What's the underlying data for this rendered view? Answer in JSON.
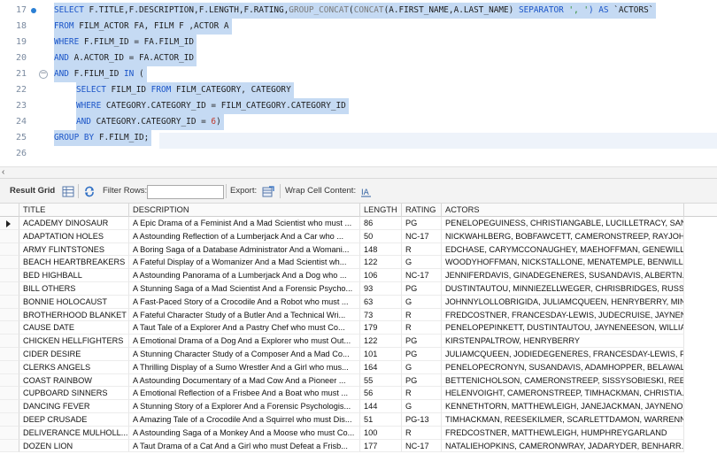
{
  "editor": {
    "lines": [
      {
        "num": "17"
      },
      {
        "num": "18"
      },
      {
        "num": "19"
      },
      {
        "num": "20"
      },
      {
        "num": "21"
      },
      {
        "num": "22"
      },
      {
        "num": "23"
      },
      {
        "num": "24"
      },
      {
        "num": "25"
      },
      {
        "num": "26"
      }
    ],
    "fold_glyph": "−",
    "tokens": {
      "l17_select": "SELECT ",
      "l17_cols": "F.TITLE,F.DESCRIPTION,F.LENGTH,F.RATING,",
      "l17_gc": "GROUP_CONCAT",
      "l17_p1": "(",
      "l17_concat": "CONCAT",
      "l17_args": "(A.FIRST_NAME,A.LAST_NAME) ",
      "l17_sep": "SEPARATOR ",
      "l17_str": "', '",
      "l17_as": ") AS ",
      "l17_alias": "`ACTORS`",
      "l18_from": "FROM ",
      "l18_rest": "FILM_ACTOR FA, FILM F ,ACTOR A",
      "l19_where": "WHERE ",
      "l19_rest": "F.FILM_ID = FA.FILM_ID",
      "l20_and": "AND ",
      "l20_rest": "A.ACTOR_ID = FA.ACTOR_ID",
      "l21_and": "AND ",
      "l21_mid": "F.FILM_ID ",
      "l21_in": "IN ",
      "l21_paren": "(",
      "l22_select": "SELECT ",
      "l22_mid": "FILM_ID ",
      "l22_from": "FROM ",
      "l22_rest": "FILM_CATEGORY, CATEGORY",
      "l23_where": "WHERE ",
      "l23_rest": "CATEGORY.CATEGORY_ID = FILM_CATEGORY.CATEGORY_ID",
      "l24_and": "AND ",
      "l24_mid": "CATEGORY.CATEGORY_ID = ",
      "l24_num": "6",
      "l24_close": ")",
      "l25_group": "GROUP BY ",
      "l25_rest": "F.FILM_ID;"
    }
  },
  "toolbar": {
    "result_grid_label": "Result Grid",
    "filter_rows_label": "Filter Rows:",
    "filter_rows_value": "",
    "export_label": "Export:",
    "wrap_label": "Wrap Cell Content:"
  },
  "grid": {
    "columns": [
      "TITLE",
      "DESCRIPTION",
      "LENGTH",
      "RATING",
      "ACTORS"
    ],
    "rows": [
      {
        "title": "ACADEMY DINOSAUR",
        "description": "A Epic Drama of a Feminist And a Mad Scientist who must ...",
        "length": "86",
        "rating": "PG",
        "actors": "PENELOPEGUINESS, CHRISTIANGABLE, LUCILLETRACY, SAN..."
      },
      {
        "title": "ADAPTATION HOLES",
        "description": "A Astounding Reflection of a Lumberjack And a Car who ...",
        "length": "50",
        "rating": "NC-17",
        "actors": "NICKWAHLBERG, BOBFAWCETT, CAMERONSTREEP, RAYJOH..."
      },
      {
        "title": "ARMY FLINTSTONES",
        "description": "A Boring Saga of a Database Administrator And a Womani...",
        "length": "148",
        "rating": "R",
        "actors": "EDCHASE, CARYMCCONAUGHEY, MAEHOFFMAN, GENEWILLI..."
      },
      {
        "title": "BEACH HEARTBREAKERS",
        "description": "A Fateful Display of a Womanizer And a Mad Scientist wh...",
        "length": "122",
        "rating": "G",
        "actors": "WOODYHOFFMAN, NICKSTALLONE, MENATEMPLE, BENWILLI..."
      },
      {
        "title": "BED HIGHBALL",
        "description": "A Astounding Panorama of a Lumberjack And a Dog who ...",
        "length": "106",
        "rating": "NC-17",
        "actors": "JENNIFERDAVIS, GINADEGENERES, SUSANDAVIS, ALBERTN..."
      },
      {
        "title": "BILL OTHERS",
        "description": "A Stunning Saga of a Mad Scientist And a Forensic Psycho...",
        "length": "93",
        "rating": "PG",
        "actors": "DUSTINTAUTOU, MINNIEZELLWEGER, CHRISBRIDGES, RUSS..."
      },
      {
        "title": "BONNIE HOLOCAUST",
        "description": "A Fast-Paced Story of a Crocodile And a Robot who must ...",
        "length": "63",
        "rating": "G",
        "actors": "JOHNNYLOLLOBRIGIDA, JULIAMCQUEEN, HENRYBERRY, MIN..."
      },
      {
        "title": "BROTHERHOOD BLANKET",
        "description": "A Fateful Character Study of a Butler And a Technical Wri...",
        "length": "73",
        "rating": "R",
        "actors": "FREDCOSTNER, FRANCESDAY-LEWIS, JUDECRUISE, JAYNEN..."
      },
      {
        "title": "CAUSE DATE",
        "description": "A Taut Tale of a Explorer And a Pastry Chef who must Co...",
        "length": "179",
        "rating": "R",
        "actors": "PENELOPEPINKETT, DUSTINTAUTOU, JAYNENEESON, WILLIA..."
      },
      {
        "title": "CHICKEN HELLFIGHTERS",
        "description": "A Emotional Drama of a Dog And a Explorer who must Out...",
        "length": "122",
        "rating": "PG",
        "actors": "KIRSTENPALTROW, HENRYBERRY"
      },
      {
        "title": "CIDER DESIRE",
        "description": "A Stunning Character Study of a Composer And a Mad Co...",
        "length": "101",
        "rating": "PG",
        "actors": "JULIAMCQUEEN, JODIEDEGENERES, FRANCESDAY-LEWIS, P..."
      },
      {
        "title": "CLERKS ANGELS",
        "description": "A Thrilling Display of a Sumo Wrestler And a Girl who mus...",
        "length": "164",
        "rating": "G",
        "actors": "PENELOPECRONYN, SUSANDAVIS, ADAMHOPPER, BELAWAL..."
      },
      {
        "title": "COAST RAINBOW",
        "description": "A Astounding Documentary of a Mad Cow And a Pioneer ...",
        "length": "55",
        "rating": "PG",
        "actors": "BETTENICHOLSON, CAMERONSTREEP, SISSYSOBIESKI, REES..."
      },
      {
        "title": "CUPBOARD SINNERS",
        "description": "A Emotional Reflection of a Frisbee And a Boat who must ...",
        "length": "56",
        "rating": "R",
        "actors": "HELENVOIGHT, CAMERONSTREEP, TIMHACKMAN, CHRISTIA..."
      },
      {
        "title": "DANCING FEVER",
        "description": "A Stunning Story of a Explorer And a Forensic Psychologis...",
        "length": "144",
        "rating": "G",
        "actors": "KENNETHTORN, MATTHEWLEIGH, JANEJACKMAN, JAYNENOL..."
      },
      {
        "title": "DEEP CRUSADE",
        "description": "A Amazing Tale of a Crocodile And a Squirrel who must Dis...",
        "length": "51",
        "rating": "PG-13",
        "actors": "TIMHACKMAN, REESEKILMER, SCARLETTDAMON, WARRENN..."
      },
      {
        "title": "DELIVERANCE MULHOLL...",
        "description": "A Astounding Saga of a Monkey And a Moose who must Co...",
        "length": "100",
        "rating": "R",
        "actors": "FREDCOSTNER, MATTHEWLEIGH, HUMPHREYGARLAND"
      },
      {
        "title": "DOZEN LION",
        "description": "A Taut Drama of a Cat And a Girl who must Defeat a Frisb...",
        "length": "177",
        "rating": "NC-17",
        "actors": "NATALIEHOPKINS, CAMERONWRAY, JADARYDER, BENHARR..."
      }
    ]
  },
  "icons": {
    "marker": "breakpoint-dot-icon",
    "grid": "grid-icon",
    "refresh": "refresh-icon",
    "export": "export-icon",
    "wrap": "wrap-text-icon"
  },
  "colors": {
    "selection": "#c5daf3",
    "keyword": "#1b55c8",
    "string": "#2e8b2e",
    "number": "#c0392b"
  }
}
